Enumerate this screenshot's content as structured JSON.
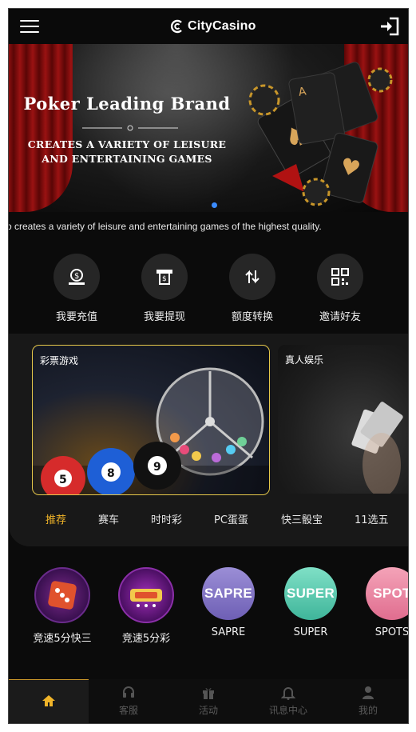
{
  "header": {
    "brand": "CityCasino",
    "menu_icon": "hamburger-menu-icon",
    "login_icon": "sign-in-icon"
  },
  "banner": {
    "title": "Poker Leading Brand",
    "subtitle_line1": "CREATES A VARIETY OF LEISURE",
    "subtitle_line2": "AND ENTERTAINING GAMES",
    "active_dot_color": "#3b8cff"
  },
  "marquee": {
    "text": "o creates a variety of leisure and entertaining games of the highest quality."
  },
  "actions": [
    {
      "label": "我要充值",
      "icon": "deposit-icon"
    },
    {
      "label": "我要提现",
      "icon": "withdraw-icon"
    },
    {
      "label": "额度转换",
      "icon": "transfer-icon"
    },
    {
      "label": "邀请好友",
      "icon": "qr-code-icon"
    }
  ],
  "game_cards": [
    {
      "label": "彩票游戏"
    },
    {
      "label": "真人娱乐"
    }
  ],
  "tabs": [
    {
      "label": "推荐",
      "active": true
    },
    {
      "label": "赛车"
    },
    {
      "label": "时时彩"
    },
    {
      "label": "PC蛋蛋"
    },
    {
      "label": "快三骰宝"
    },
    {
      "label": "11选五"
    }
  ],
  "hot_games": [
    {
      "label": "竞速5分快三",
      "badge": ""
    },
    {
      "label": "竞速5分彩",
      "badge": ""
    },
    {
      "label": "SAPRE",
      "badge": "SAPRE"
    },
    {
      "label": "SUPER",
      "badge": "SUPER"
    },
    {
      "label": "SPOTS",
      "badge": "SPOT"
    }
  ],
  "bottom_nav": [
    {
      "label": "",
      "icon": "home-icon",
      "active": true
    },
    {
      "label": "客服",
      "icon": "headset-icon"
    },
    {
      "label": "活动",
      "icon": "gift-icon"
    },
    {
      "label": "讯息中心",
      "icon": "bell-icon"
    },
    {
      "label": "我的",
      "icon": "user-icon"
    }
  ],
  "colors": {
    "accent": "#f0b429",
    "background": "#0b0b0b",
    "panel": "#181818"
  }
}
